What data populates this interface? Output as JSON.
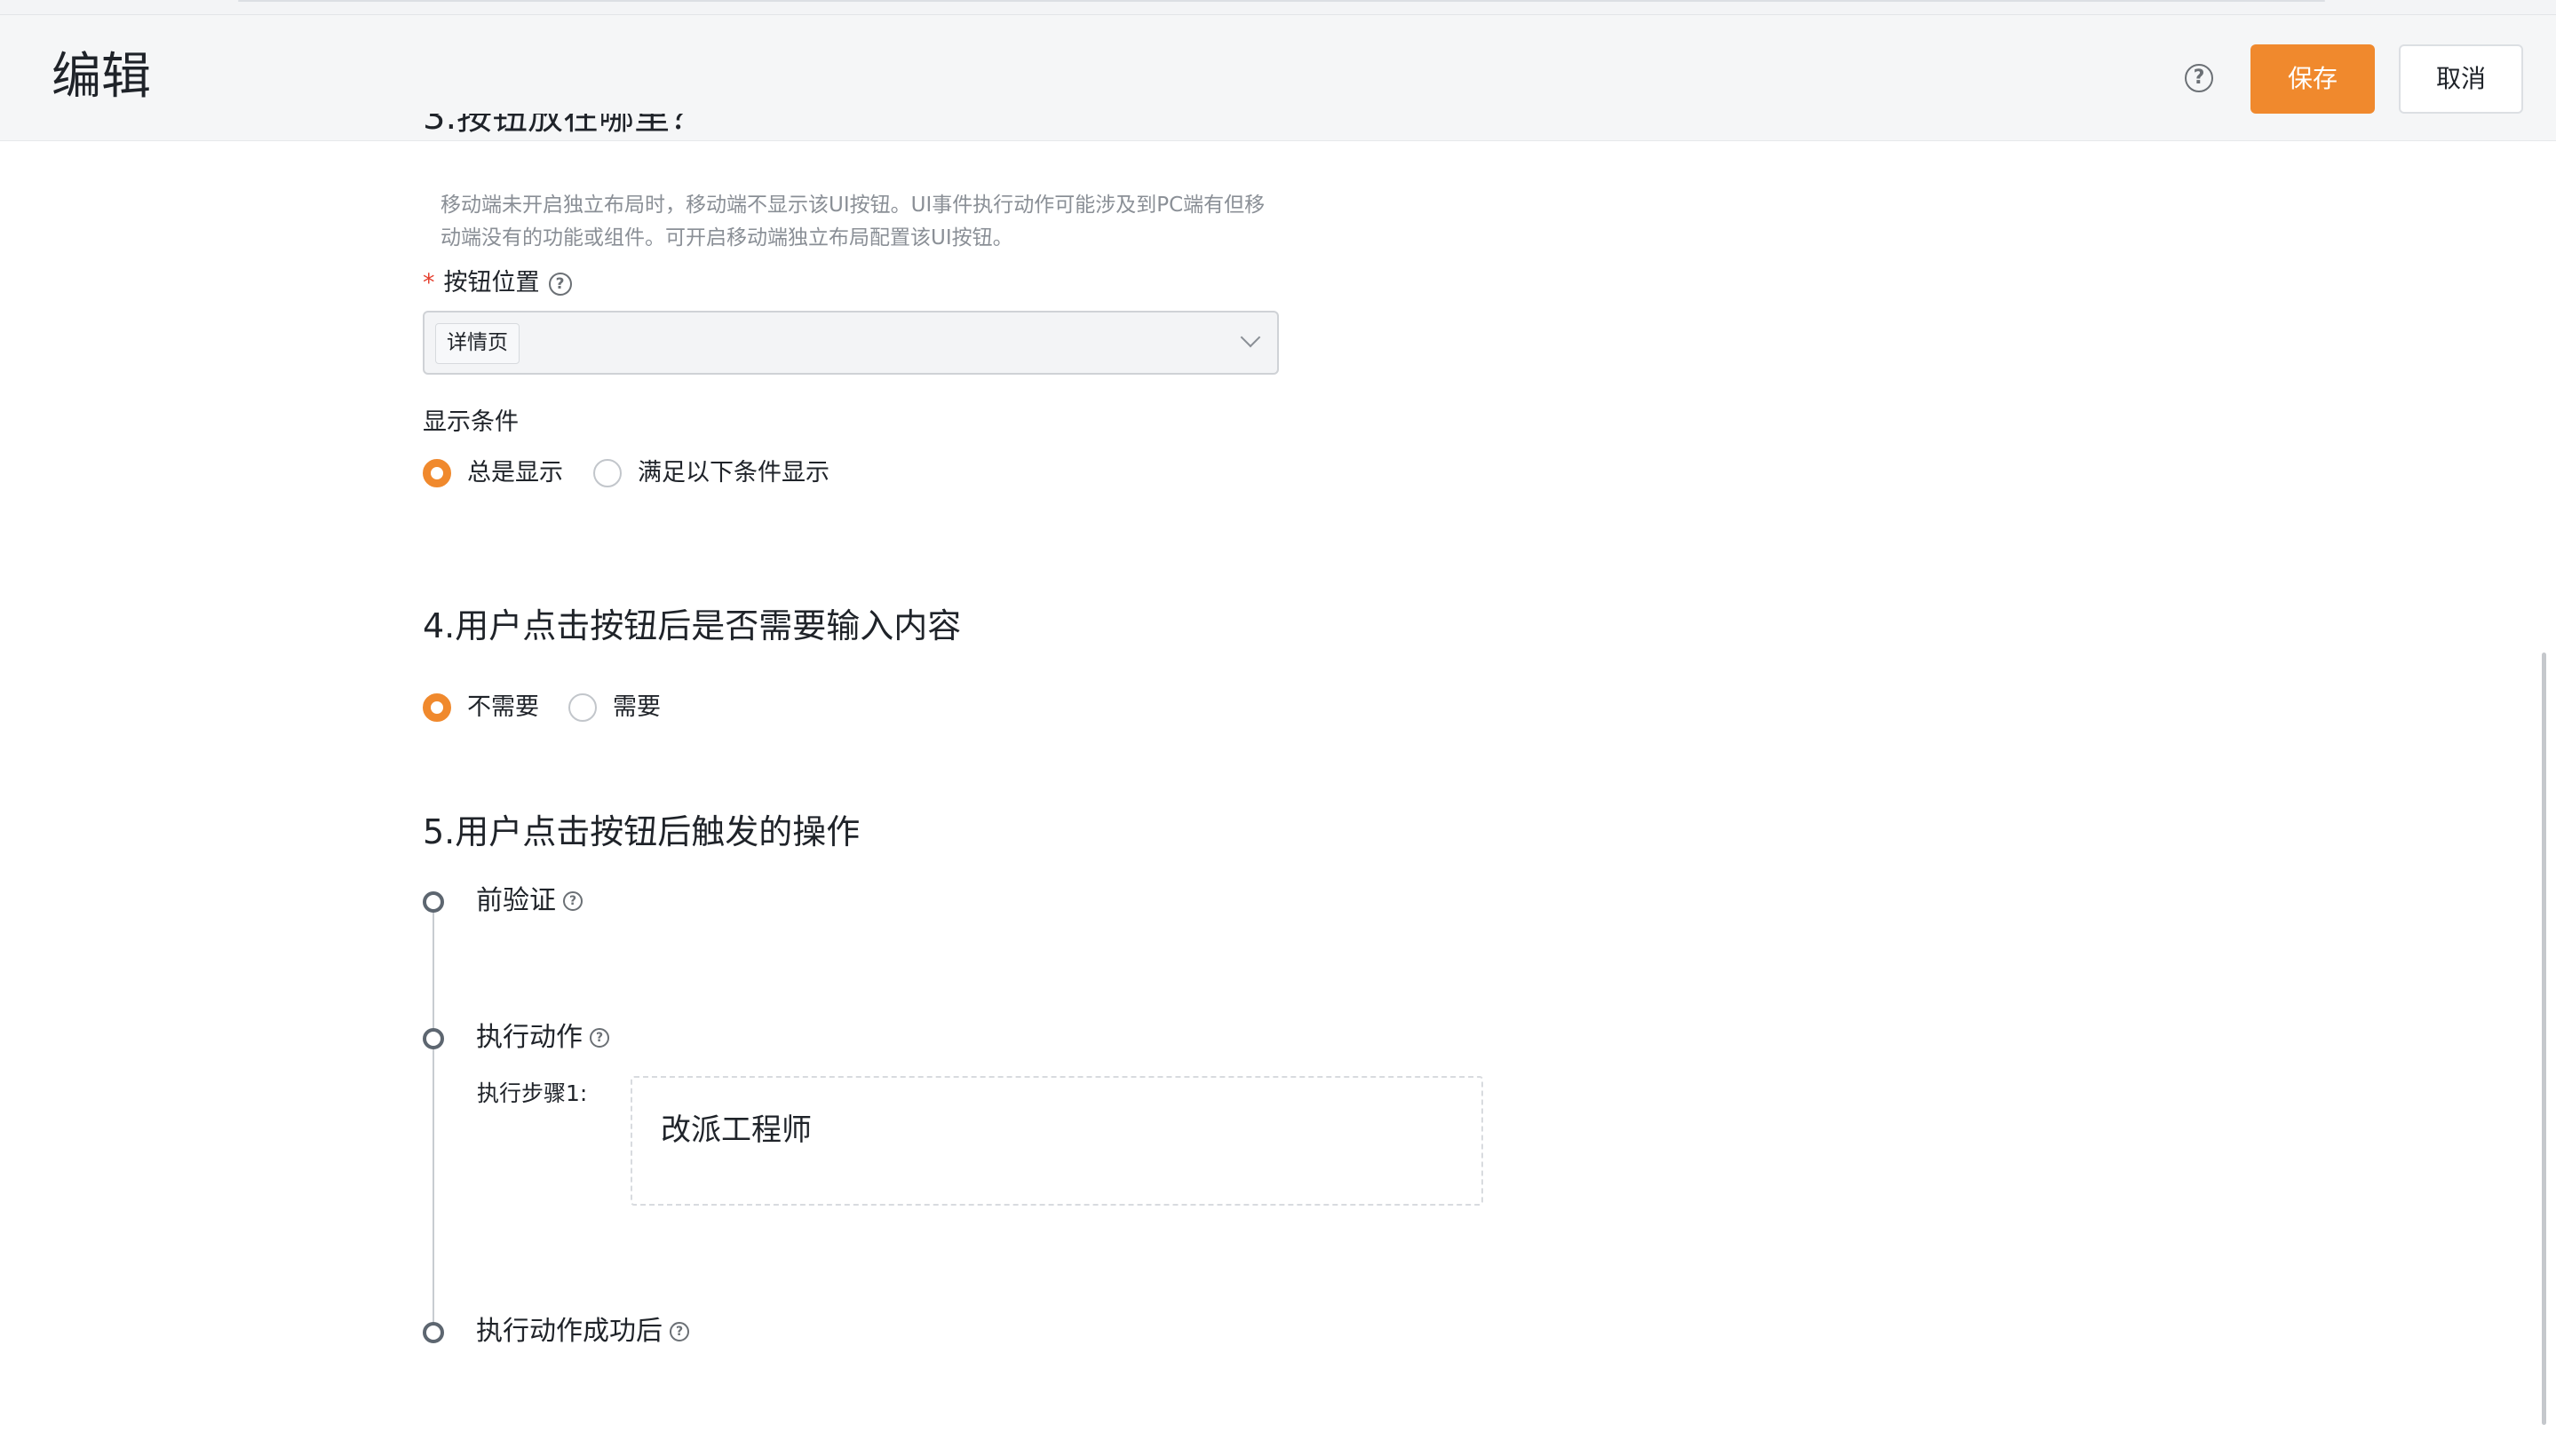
{
  "header": {
    "title": "编辑",
    "help_glyph": "?",
    "save_label": "保存",
    "cancel_label": "取消"
  },
  "section3": {
    "title_partial": "3.按钮放在哪里？",
    "hint": "移动端未开启独立布局时，移动端不显示该UI按钮。UI事件执行动作可能涉及到PC端有但移动端没有的功能或组件。可开启移动端独立布局配置该UI按钮。",
    "position_label": "按钮位置",
    "required_mark": "*",
    "position_value": "详情页",
    "display_condition_label": "显示条件",
    "display_options": [
      {
        "label": "总是显示",
        "selected": true
      },
      {
        "label": "满足以下条件显示",
        "selected": false
      }
    ]
  },
  "section4": {
    "title": "4.用户点击按钮后是否需要输入内容",
    "options": [
      {
        "label": "不需要",
        "selected": true
      },
      {
        "label": "需要",
        "selected": false
      }
    ]
  },
  "section5": {
    "title": "5.用户点击按钮后触发的操作",
    "timeline": [
      {
        "label": "前验证"
      },
      {
        "label": "执行动作"
      },
      {
        "label": "执行动作成功后"
      }
    ],
    "step_label": "执行步骤1:",
    "step_value": "改派工程师"
  },
  "colors": {
    "accent": "#f0892d",
    "header_bg": "#f5f6f7",
    "text": "#1f2329",
    "muted": "#8a8f96"
  },
  "icons": {
    "help": "question-circle-icon",
    "select_arrow": "chevron-down-icon",
    "timeline_node": "circle-outline-icon"
  }
}
